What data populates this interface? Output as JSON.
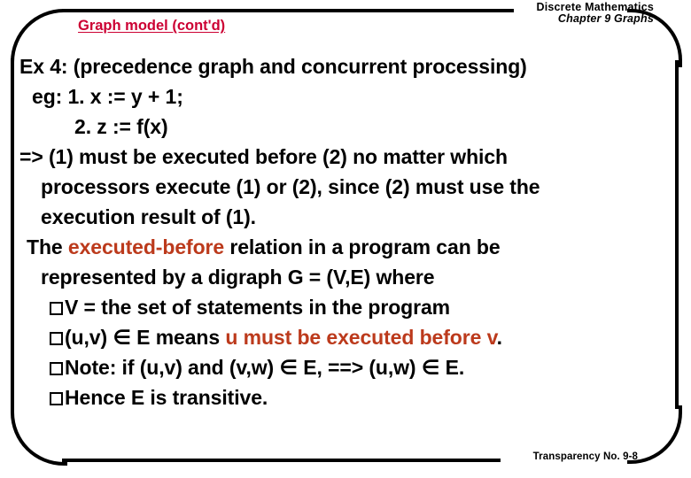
{
  "header": {
    "course": "Discrete Mathematics",
    "chapter": "Chapter 9 Graphs"
  },
  "title": "Graph model (cont'd)",
  "colors": {
    "title_red": "#CC0033",
    "accent_red": "#BC3A1C",
    "text_black": "#000000",
    "background": "#FFFFFF"
  },
  "body": {
    "line1": "Ex 4: (precedence graph and concurrent processing)",
    "line2": "eg:  1. x := y + 1;",
    "line3": "2. z := f(x)",
    "line4": "=> (1) must be executed before (2) no matter which",
    "line5": "processors execute (1) or (2), since (2) must use the",
    "line6": "execution result of (1).",
    "line7_a": "The ",
    "line7_accent": "executed-before",
    "line7_b": " relation in a program can be",
    "line8": "represented by a digraph G = (V,E) where",
    "bullet1": "V = the set of statements in the program",
    "bullet2_a": "(u,v) ",
    "bullet2_sym": "∈",
    "bullet2_b": " E means ",
    "bullet2_accent": "u must be executed before v",
    "bullet2_c": ".",
    "bullet3_a": "Note: if (u,v) and (v,w) ",
    "bullet3_sym1": "∈",
    "bullet3_b": " E, ==> (u,w) ",
    "bullet3_sym2": "∈",
    "bullet3_c": " E.",
    "bullet4": "Hence E is transitive."
  },
  "footer": {
    "transparency": "Transparency No. 9-8"
  }
}
